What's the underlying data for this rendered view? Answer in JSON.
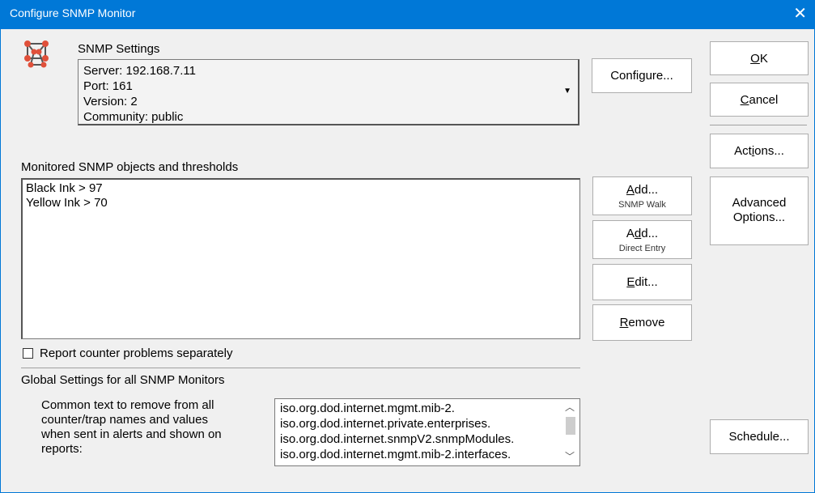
{
  "window": {
    "title": "Configure SNMP Monitor",
    "close": "✕"
  },
  "snmp": {
    "heading": "SNMP Settings",
    "lines": [
      "Server: 192.168.7.11",
      "Port: 161",
      "Version: 2",
      "Community: public"
    ],
    "configure_label": "Configure..."
  },
  "monitored": {
    "heading": "Monitored SNMP objects and thresholds",
    "items": [
      "Black Ink > 97",
      "Yellow Ink > 70"
    ]
  },
  "buttons": {
    "add_walk": {
      "main_pre": "",
      "main_u": "A",
      "main_post": "dd...",
      "sub": "SNMP Walk"
    },
    "add_direct": {
      "main_pre": "A",
      "main_u": "d",
      "main_post": "d...",
      "sub": "Direct Entry"
    },
    "edit": {
      "pre": "",
      "u": "E",
      "post": "dit..."
    },
    "remove": {
      "pre": "",
      "u": "R",
      "post": "emove"
    },
    "ok": {
      "pre": "",
      "u": "O",
      "post": "K"
    },
    "cancel": {
      "pre": "",
      "u": "C",
      "post": "ancel"
    },
    "actions": {
      "pre": "Act",
      "u": "i",
      "post": "ons..."
    },
    "advanced": {
      "line1": "Advanced",
      "line2": "Options..."
    },
    "schedule": "Schedule..."
  },
  "report_checkbox": {
    "label": "Report counter problems separately",
    "checked": false
  },
  "global": {
    "heading": "Global Settings for all SNMP Monitors",
    "description": [
      "Common text to remove from all",
      "counter/trap names and values",
      "when sent in alerts and shown on",
      "reports:"
    ],
    "remove_text": [
      "iso.org.dod.internet.mgmt.mib-2.",
      "iso.org.dod.internet.private.enterprises.",
      "iso.org.dod.internet.snmpV2.snmpModules.",
      "iso.org.dod.internet.mgmt.mib-2.interfaces."
    ]
  },
  "icons": {
    "app": "molecule-icon",
    "close": "close-icon",
    "dropdown": "chevron-down-icon"
  },
  "colors": {
    "titlebar": "#0078d7",
    "icon_red": "#e0503a"
  }
}
